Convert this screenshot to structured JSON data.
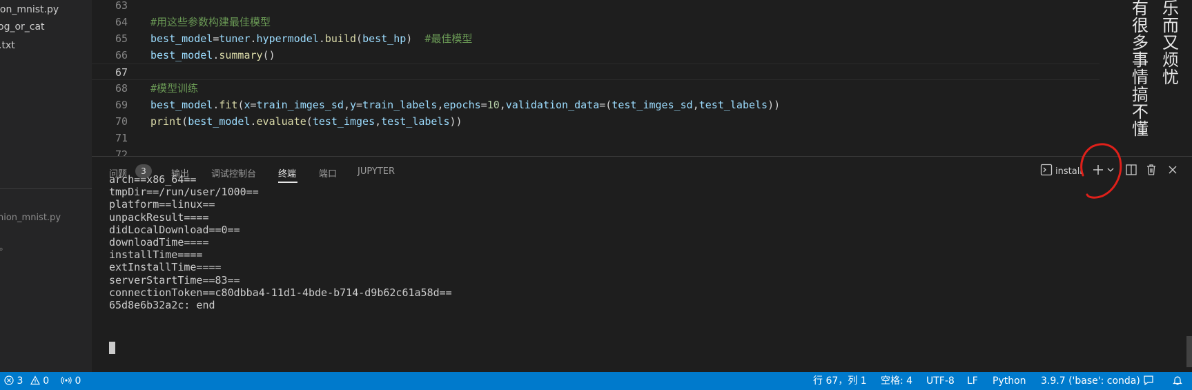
{
  "sidebar": {
    "files": [
      "ion_mnist.py",
      "og_or_cat",
      "当.txt"
    ],
    "outline_items": [
      "nion_mnist.py",
      "息。"
    ]
  },
  "editor": {
    "lines": [
      {
        "num": "63"
      },
      {
        "num": "64",
        "parts": [
          {
            "t": "#用这些参数构建最佳模型",
            "c": "comment"
          }
        ]
      },
      {
        "num": "65",
        "parts": [
          {
            "t": "best_model",
            "c": "var"
          },
          {
            "t": "=",
            "c": "plain"
          },
          {
            "t": "tuner",
            "c": "var"
          },
          {
            "t": ".",
            "c": "plain"
          },
          {
            "t": "hypermodel",
            "c": "var"
          },
          {
            "t": ".",
            "c": "plain"
          },
          {
            "t": "build",
            "c": "func"
          },
          {
            "t": "(",
            "c": "plain"
          },
          {
            "t": "best_hp",
            "c": "var"
          },
          {
            "t": ")  ",
            "c": "plain"
          },
          {
            "t": "#最佳模型",
            "c": "comment"
          }
        ]
      },
      {
        "num": "66",
        "parts": [
          {
            "t": "best_model",
            "c": "var"
          },
          {
            "t": ".",
            "c": "plain"
          },
          {
            "t": "summary",
            "c": "func"
          },
          {
            "t": "()",
            "c": "plain"
          }
        ]
      },
      {
        "num": "67",
        "active": true
      },
      {
        "num": "68",
        "parts": [
          {
            "t": "#模型训练",
            "c": "comment"
          }
        ]
      },
      {
        "num": "69",
        "parts": [
          {
            "t": "best_model",
            "c": "var"
          },
          {
            "t": ".",
            "c": "plain"
          },
          {
            "t": "fit",
            "c": "func"
          },
          {
            "t": "(",
            "c": "plain"
          },
          {
            "t": "x",
            "c": "var"
          },
          {
            "t": "=",
            "c": "plain"
          },
          {
            "t": "train_imges_sd",
            "c": "var"
          },
          {
            "t": ",",
            "c": "plain"
          },
          {
            "t": "y",
            "c": "var"
          },
          {
            "t": "=",
            "c": "plain"
          },
          {
            "t": "train_labels",
            "c": "var"
          },
          {
            "t": ",",
            "c": "plain"
          },
          {
            "t": "epochs",
            "c": "var"
          },
          {
            "t": "=",
            "c": "plain"
          },
          {
            "t": "10",
            "c": "num"
          },
          {
            "t": ",",
            "c": "plain"
          },
          {
            "t": "validation_data",
            "c": "var"
          },
          {
            "t": "=(",
            "c": "plain"
          },
          {
            "t": "test_imges_sd",
            "c": "var"
          },
          {
            "t": ",",
            "c": "plain"
          },
          {
            "t": "test_labels",
            "c": "var"
          },
          {
            "t": "))",
            "c": "plain"
          }
        ]
      },
      {
        "num": "70",
        "parts": [
          {
            "t": "print",
            "c": "func"
          },
          {
            "t": "(",
            "c": "plain"
          },
          {
            "t": "best_model",
            "c": "var"
          },
          {
            "t": ".",
            "c": "plain"
          },
          {
            "t": "evaluate",
            "c": "func"
          },
          {
            "t": "(",
            "c": "plain"
          },
          {
            "t": "test_imges",
            "c": "var"
          },
          {
            "t": ",",
            "c": "plain"
          },
          {
            "t": "test_labels",
            "c": "var"
          },
          {
            "t": "))",
            "c": "plain"
          }
        ]
      },
      {
        "num": "71"
      },
      {
        "num": "72"
      }
    ],
    "vertical_text": [
      "有很多事情搞不懂",
      "乐而又烦忧"
    ]
  },
  "panel": {
    "tabs": [
      {
        "label": "问题",
        "badge": "3"
      },
      {
        "label": "输出"
      },
      {
        "label": "调试控制台"
      },
      {
        "label": "终端",
        "active": true
      },
      {
        "label": "端口"
      },
      {
        "label": "JUPYTER"
      }
    ],
    "terminal_name": "install",
    "icons": [
      "terminal-icon",
      "plus-icon",
      "chevron-down-icon",
      "split-icon",
      "trash-icon",
      "close-icon"
    ],
    "terminal_lines": [
      "arch==x86_64==",
      "tmpDir==/run/user/1000==",
      "platform==linux==",
      "unpackResult====",
      "didLocalDownload==0==",
      "downloadTime====",
      "installTime====",
      "extInstallTime====",
      "serverStartTime==83==",
      "connectionToken==c80dbba4-11d1-4bde-b714-d9b62c61a58d==",
      "65d8e6b32a2c: end"
    ]
  },
  "statusbar": {
    "errors": "3",
    "warnings": "0",
    "ports": "0",
    "position": "行 67，列 1",
    "spaces": "空格: 4",
    "encoding": "UTF-8",
    "eol": "LF",
    "language": "Python",
    "interpreter": "3.9.7 ('base': conda)",
    "color": "#007acc"
  }
}
